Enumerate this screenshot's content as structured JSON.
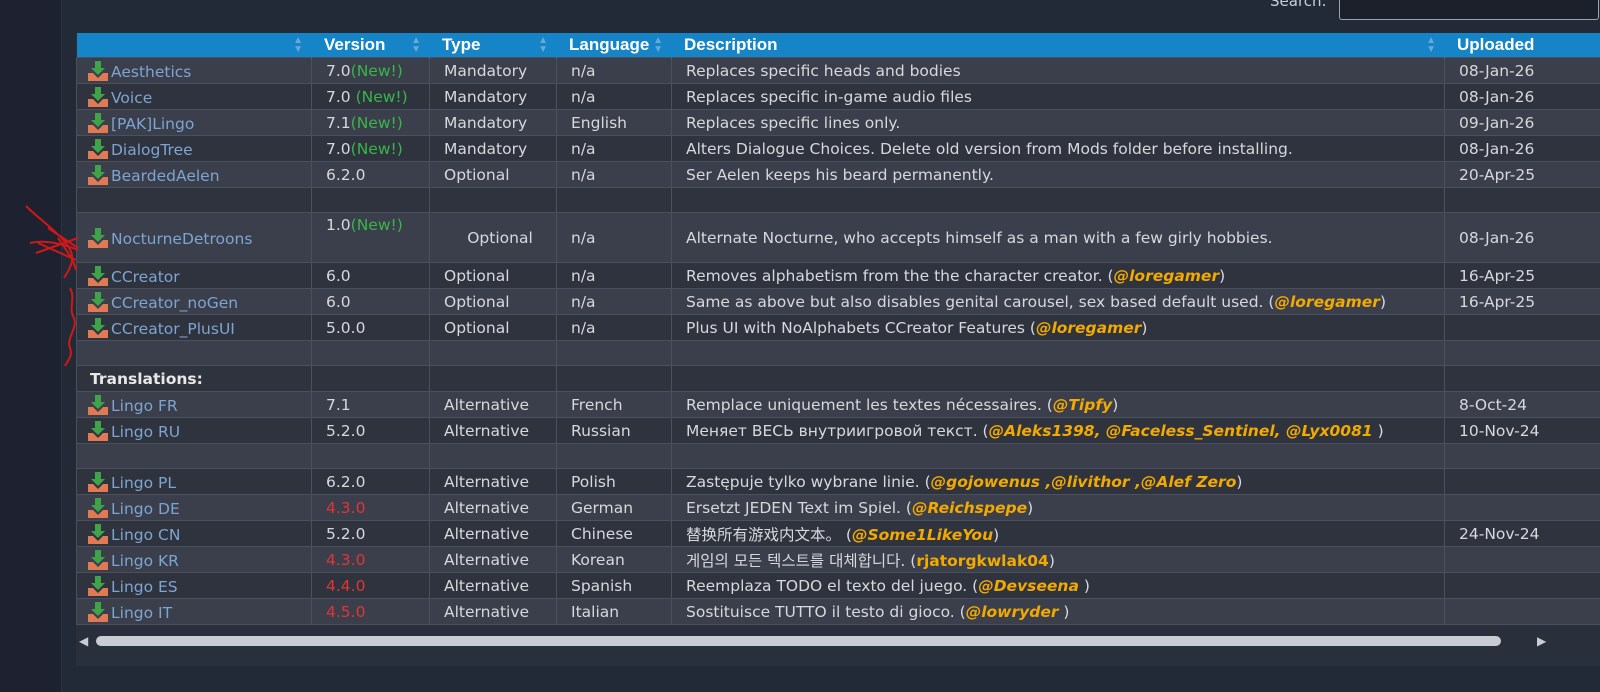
{
  "search": {
    "label": "Search:",
    "value": "",
    "placeholder": ""
  },
  "table": {
    "columns": [
      "",
      "Version",
      "Type",
      "Language",
      "Description",
      "Uploaded"
    ],
    "rows": [
      {
        "name": "Aesthetics",
        "version": "7.0",
        "new": "(New!)",
        "type": "Mandatory",
        "lang": "n/a",
        "desc": "Replaces specific heads and bodies",
        "uploaded": "08-Jan-26"
      },
      {
        "name": "Voice",
        "version": "7.0 ",
        "new": "(New!)",
        "type": "Mandatory",
        "lang": "n/a",
        "desc": "Replaces specific in-game audio files",
        "uploaded": "08-Jan-26"
      },
      {
        "name": "[PAK]Lingo",
        "version": "7.1",
        "new": "(New!)",
        "type": "Mandatory",
        "lang": "English",
        "desc": "Replaces specific lines only.",
        "uploaded": "09-Jan-26"
      },
      {
        "name": "DialogTree",
        "version": "7.0",
        "new": "(New!)",
        "type": "Mandatory",
        "lang": "n/a",
        "desc": "Alters Dialogue Choices. Delete old version from Mods folder before installing.",
        "uploaded": "08-Jan-26"
      },
      {
        "name": "BeardedAelen",
        "version": "6.2.0",
        "new": "",
        "type": "Optional",
        "lang": "n/a",
        "desc": "Ser Aelen keeps his beard permanently.",
        "uploaded": "20-Apr-25"
      },
      {
        "name": "NocturneDetroons",
        "version": "1.0",
        "new": "(New!)",
        "type": "Optional",
        "lang": "n/a",
        "desc": "Alternate Nocturne, who accepts himself as a man with a few girly hobbies.",
        "uploaded": "08-Jan-26"
      },
      {
        "name": "CCreator",
        "version": "6.0",
        "type": "Optional",
        "lang": "n/a",
        "desc": "Removes alphabetism from the the character creator. (",
        "credit": "@loregamer",
        "desc_end": ")",
        "uploaded": "16-Apr-25"
      },
      {
        "name": "CCreator_noGen",
        "version": "6.0",
        "type": "Optional",
        "lang": "n/a",
        "desc": "Same as above but also disables genital carousel, sex based default used. (",
        "credit": "@loregamer",
        "desc_end": ")",
        "uploaded": "16-Apr-25"
      },
      {
        "name": "CCreator_PlusUI",
        "version": "5.0.0",
        "type": "Optional",
        "lang": "n/a",
        "desc": "Plus UI with NoAlphabets CCreator Features (",
        "credit": "@loregamer",
        "desc_end": ")",
        "uploaded": ""
      }
    ],
    "section_title": "Translations:",
    "translations": [
      {
        "name": "Lingo FR",
        "version": "7.1",
        "type": "Alternative",
        "lang": "French",
        "desc": "Remplace uniquement les textes nécessaires. (",
        "credit": "@Tipfy",
        "desc_end": ")",
        "uploaded": "8-Oct-24"
      },
      {
        "name": "Lingo RU",
        "version": "5.2.0",
        "type": "Alternative",
        "lang": "Russian",
        "desc": "Меняет ВЕСЬ внутриигровой текст. (",
        "credit": "@Aleks1398, @Faceless_Sentinel, @Lyx0081",
        "desc_end": " )",
        "uploaded": "10-Nov-24"
      }
    ],
    "translations2": [
      {
        "name": "Lingo PL",
        "version": "6.2.0",
        "type": "Alternative",
        "lang": "Polish",
        "desc": "Zastępuje tylko wybrane linie. (",
        "credit": "@gojowenus ,@livithor ,@Alef Zero",
        "desc_end": ")",
        "uploaded": ""
      },
      {
        "name": "Lingo DE",
        "version": "4.3.0",
        "type": "Alternative",
        "lang": "German",
        "desc": "Ersetzt JEDEN Text im Spiel. (",
        "credit": "@Reichspepe",
        "desc_end": ")",
        "uploaded": ""
      },
      {
        "name": "Lingo CN",
        "version": "5.2.0",
        "type": "Alternative",
        "lang": "Chinese",
        "desc": "替换所有游戏内文本。 (",
        "credit": "@Some1LikeYou",
        "desc_end": ")",
        "uploaded": "24-Nov-24"
      },
      {
        "name": "Lingo KR",
        "version": "4.3.0",
        "type": "Alternative",
        "lang": "Korean",
        "desc": "게임의 모든 텍스트를 대체합니다. (",
        "credit": "rjatorgkwlak04",
        "desc_end": ")",
        "uploaded": ""
      },
      {
        "name": "Lingo ES",
        "version": "4.4.0",
        "type": "Alternative",
        "lang": "Spanish",
        "desc": "Reemplaza TODO el texto del juego. (",
        "credit": "@Devseena",
        "desc_end": " )",
        "uploaded": ""
      },
      {
        "name": "Lingo IT",
        "version": "4.5.0",
        "type": "Alternative",
        "lang": "Italian",
        "desc": "Sostituisce TUTTO il testo di gioco. (",
        "credit": "@lowryder",
        "desc_end": " )",
        "uploaded": ""
      }
    ]
  },
  "colors": {
    "header": "#1685c8",
    "link": "#7ea4d1",
    "new": "#39b54a",
    "old_version": "#e03535",
    "credit": "#f2a900",
    "annotation": "#d01818"
  },
  "icons": {
    "download": "download-tray-icon",
    "scroll_left": "scroll-left-arrow-icon",
    "scroll_right": "scroll-right-arrow-icon"
  }
}
